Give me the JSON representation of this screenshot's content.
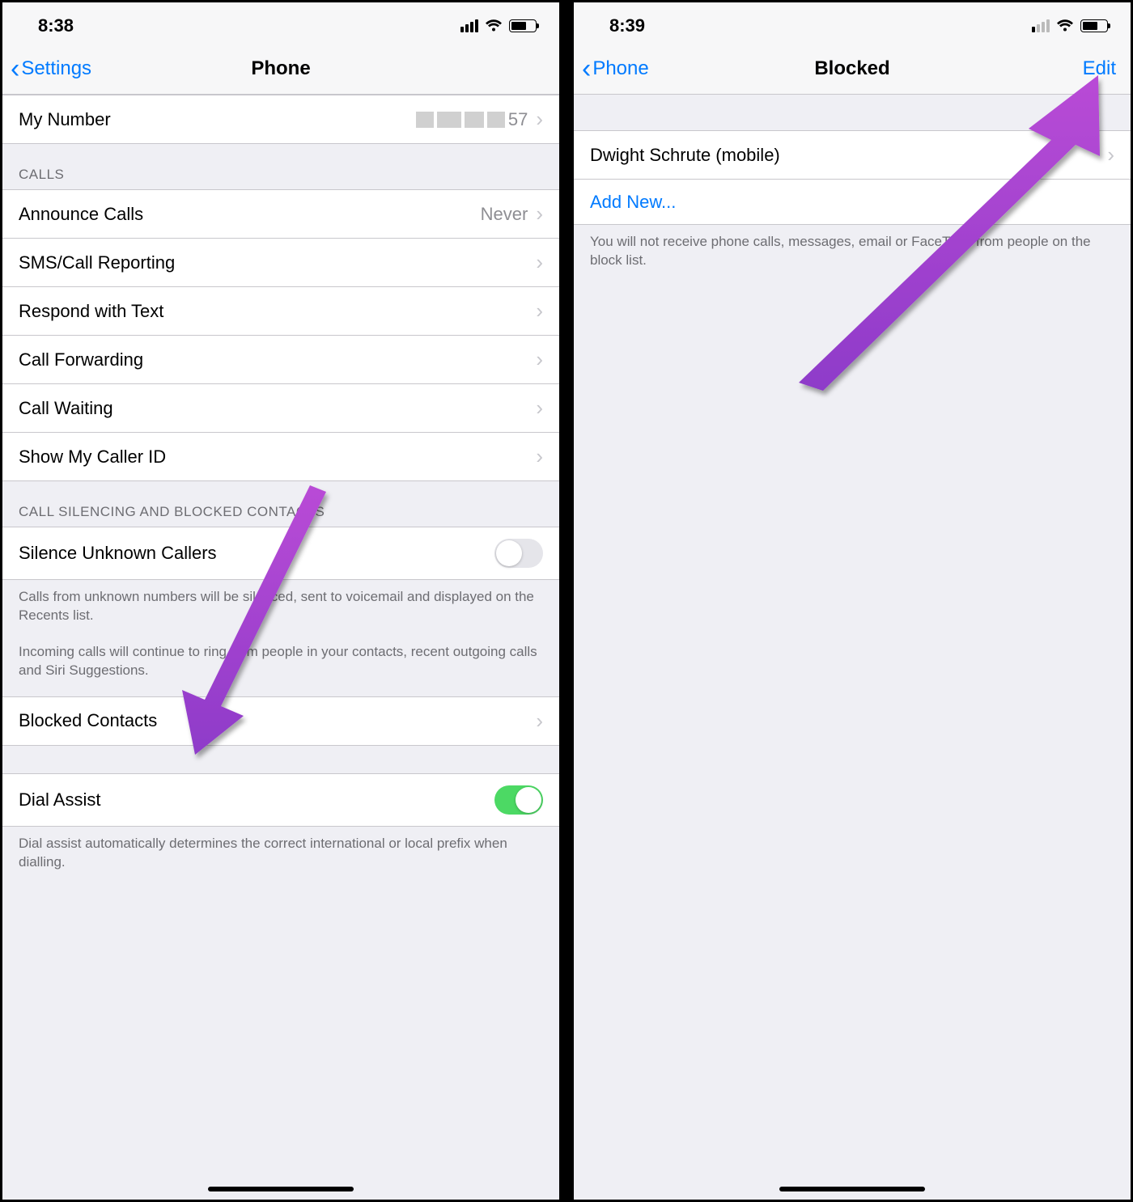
{
  "left": {
    "status": {
      "time": "8:38"
    },
    "nav": {
      "back": "Settings",
      "title": "Phone"
    },
    "my_number": {
      "label": "My Number",
      "value_suffix": "57"
    },
    "calls_header": "CALLS",
    "calls": {
      "announce": {
        "label": "Announce Calls",
        "value": "Never"
      },
      "sms_reporting": {
        "label": "SMS/Call Reporting"
      },
      "respond_text": {
        "label": "Respond with Text"
      },
      "call_fwd": {
        "label": "Call Forwarding"
      },
      "call_wait": {
        "label": "Call Waiting"
      },
      "caller_id": {
        "label": "Show My Caller ID"
      }
    },
    "silencing_header": "CALL SILENCING AND BLOCKED CONTACTS",
    "silence_unknown": {
      "label": "Silence Unknown Callers"
    },
    "silence_note1": "Calls from unknown numbers will be silenced, sent to voicemail and displayed on the Recents list.",
    "silence_note2": "Incoming calls will continue to ring from people in your contacts, recent outgoing calls and Siri Suggestions.",
    "blocked_contacts": {
      "label": "Blocked Contacts"
    },
    "dial_assist": {
      "label": "Dial Assist"
    },
    "dial_note": "Dial assist automatically determines the correct international or local prefix when dialling."
  },
  "right": {
    "status": {
      "time": "8:39"
    },
    "nav": {
      "back": "Phone",
      "title": "Blocked",
      "edit": "Edit"
    },
    "entry": {
      "label": "Dwight Schrute (mobile)"
    },
    "add_new": {
      "label": "Add New..."
    },
    "note": "You will not receive phone calls, messages, email or FaceTime from people on the block list."
  }
}
